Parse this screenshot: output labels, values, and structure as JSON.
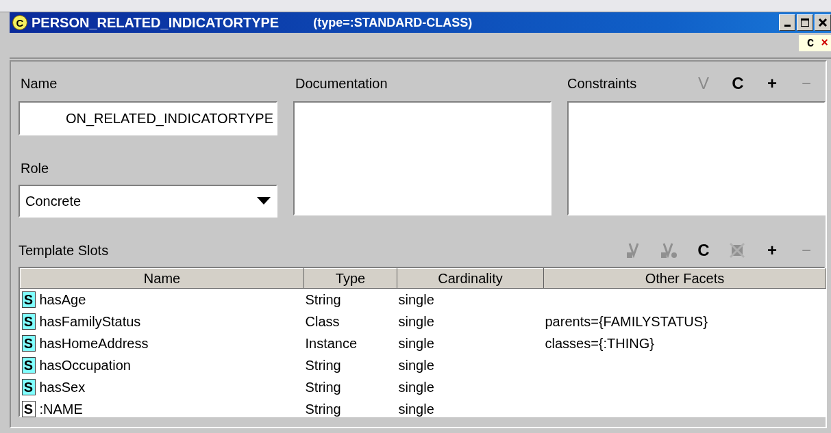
{
  "window": {
    "icon_letter": "C",
    "title": "PERSON_RELATED_INDICATORTYPE",
    "subtitle": "(type=:STANDARD-CLASS)"
  },
  "side_tab": {
    "letter": "C",
    "close": "×"
  },
  "name": {
    "label": "Name",
    "value": "ON_RELATED_INDICATORTYPE"
  },
  "role": {
    "label": "Role",
    "value": "Concrete"
  },
  "documentation": {
    "label": "Documentation"
  },
  "constraints": {
    "label": "Constraints",
    "tools": [
      {
        "kind": "glyph",
        "label": "V",
        "disabled": true
      },
      {
        "kind": "glyph",
        "label": "C",
        "disabled": false
      },
      {
        "kind": "glyph",
        "label": "+",
        "disabled": false
      },
      {
        "kind": "glyph",
        "label": "−",
        "disabled": true
      }
    ]
  },
  "template_slots": {
    "label": "Template Slots",
    "tools": [
      {
        "kind": "view-slot",
        "disabled": true
      },
      {
        "kind": "view-facet",
        "disabled": true
      },
      {
        "kind": "glyph",
        "label": "C",
        "disabled": false
      },
      {
        "kind": "remove-slot",
        "disabled": true
      },
      {
        "kind": "glyph",
        "label": "+",
        "disabled": false
      },
      {
        "kind": "glyph",
        "label": "−",
        "disabled": true
      }
    ],
    "columns": [
      "Name",
      "Type",
      "Cardinality",
      "Other Facets"
    ],
    "rows": [
      {
        "icon": "S",
        "inherited": false,
        "name": "hasAge",
        "type": "String",
        "cardinality": "single",
        "facets": ""
      },
      {
        "icon": "S",
        "inherited": false,
        "name": "hasFamilyStatus",
        "type": "Class",
        "cardinality": "single",
        "facets": "parents={FAMILYSTATUS}"
      },
      {
        "icon": "S",
        "inherited": false,
        "name": "hasHomeAddress",
        "type": "Instance",
        "cardinality": "single",
        "facets": "classes={:THING}"
      },
      {
        "icon": "S",
        "inherited": false,
        "name": "hasOccupation",
        "type": "String",
        "cardinality": "single",
        "facets": ""
      },
      {
        "icon": "S",
        "inherited": false,
        "name": "hasSex",
        "type": "String",
        "cardinality": "single",
        "facets": ""
      },
      {
        "icon": "S",
        "inherited": true,
        "name": ":NAME",
        "type": "String",
        "cardinality": "single",
        "facets": ""
      }
    ]
  }
}
